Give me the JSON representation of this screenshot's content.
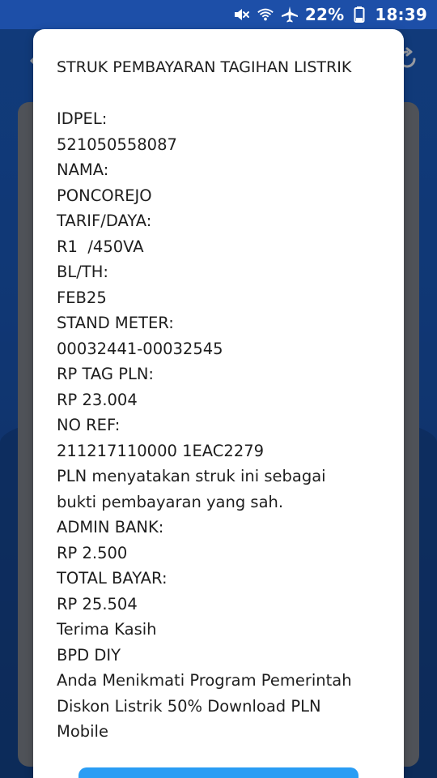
{
  "status_bar": {
    "battery_percent": "22%",
    "time": "18:39",
    "icons": [
      "mute-icon",
      "wifi-icon",
      "airplane-icon",
      "battery-icon"
    ]
  },
  "colors": {
    "status_bar_bg": "#1d4fa8",
    "app_bg": "#1b5bbd",
    "dialog_bg": "#ffffff",
    "text": "#1e1e1e",
    "button": "#2a9df4"
  },
  "background": {
    "back_icon": "back-arrow-icon",
    "refresh_icon": "refresh-icon"
  },
  "receipt": {
    "title": "STRUK PEMBAYARAN TAGIHAN LISTRIK",
    "idpel_label": "IDPEL:",
    "idpel_value": "521050558087",
    "nama_label": "NAMA:",
    "nama_value": "PONCOREJO",
    "tarif_label": "TARIF/DAYA:",
    "tarif_value": "R1  /450VA",
    "blth_label": "BL/TH:",
    "blth_value": "FEB25",
    "stand_label": "STAND METER:",
    "stand_value": "00032441-00032545",
    "tag_label": "RP TAG PLN:",
    "tag_value": "RP 23.004",
    "ref_label": "NO REF:",
    "ref_value": "211217110000 1EAC2279",
    "statement_1": "PLN menyatakan struk ini sebagai",
    "statement_2": "bukti pembayaran yang sah.",
    "admin_label": "ADMIN BANK:",
    "admin_value": "RP 2.500",
    "total_label": "TOTAL BAYAR:",
    "total_value": "RP 25.504",
    "thanks": "Terima Kasih",
    "bank": "BPD DIY",
    "promo_1": "Anda Menikmati Program Pemerintah",
    "promo_2": "Diskon Listrik 50% Download PLN",
    "promo_3": "Mobile"
  }
}
